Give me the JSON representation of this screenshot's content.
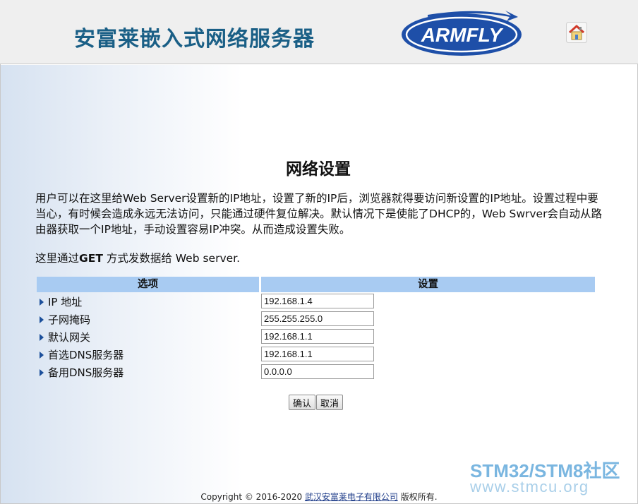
{
  "header": {
    "site_title": "安富莱嵌入式网络服务器",
    "logo_text": "ARMFLY",
    "home_icon": "home-icon"
  },
  "page": {
    "heading": "网络设置",
    "intro": "用户可以在这里给Web Server设置新的IP地址，设置了新的IP后，浏览器就得要访问新设置的IP地址。设置过程中要当心，有时候会造成永远无法访问，只能通过硬件复位解决。默认情况下是使能了DHCP的，Web Swrver会自动从路由器获取一个IP地址，手动设置容易IP冲突。从而造成设置失败。",
    "method_prefix": "这里通过",
    "method_bold": "GET",
    "method_suffix": " 方式发数据给 Web server."
  },
  "table": {
    "col_option": "选项",
    "col_setting": "设置",
    "rows": [
      {
        "label": "IP 地址",
        "value": "192.168.1.4"
      },
      {
        "label": "子网掩码",
        "value": "255.255.255.0"
      },
      {
        "label": "默认网关",
        "value": "192.168.1.1"
      },
      {
        "label": "首选DNS服务器",
        "value": "192.168.1.1"
      },
      {
        "label": "备用DNS服务器",
        "value": "0.0.0.0"
      }
    ]
  },
  "buttons": {
    "confirm": "确认",
    "cancel": "取消"
  },
  "footer": {
    "copyright": "Copyright © 2016-2020 ",
    "company_link": "武汉安富莱电子有限公司",
    "rights": " 版权所有."
  },
  "watermark": {
    "line1": "STM32/STM8社区",
    "line2": "www.stmcu.org"
  },
  "colors": {
    "title": "#1a5f86",
    "table_header": "#a8cbf2",
    "logo_blue": "#1e4fa8"
  }
}
